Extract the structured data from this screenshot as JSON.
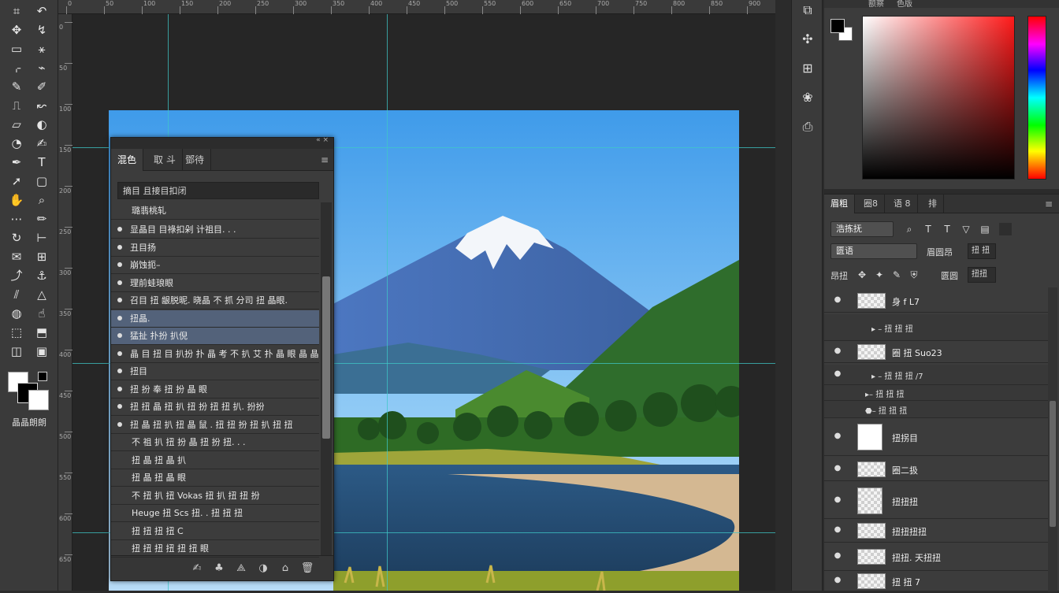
{
  "toolbar": {
    "tools": [
      {
        "icon": "marquee-icon",
        "glyph": "⌗"
      },
      {
        "icon": "undo-arc-icon",
        "glyph": "↶"
      },
      {
        "icon": "move-icon",
        "glyph": "✥"
      },
      {
        "icon": "lasso-icon",
        "glyph": "↯"
      },
      {
        "icon": "frame-icon",
        "glyph": "▭"
      },
      {
        "icon": "magic-wand-icon",
        "glyph": "⚹"
      },
      {
        "icon": "crop-icon",
        "glyph": "⌌"
      },
      {
        "icon": "eyedropper-icon",
        "glyph": "⌁"
      },
      {
        "icon": "heal-icon",
        "glyph": "✎"
      },
      {
        "icon": "brush-icon",
        "glyph": "✐"
      },
      {
        "icon": "stamp-icon",
        "glyph": "⎍"
      },
      {
        "icon": "history-brush-icon",
        "glyph": "↜"
      },
      {
        "icon": "eraser-icon",
        "glyph": "▱"
      },
      {
        "icon": "gradient-icon",
        "glyph": "◐"
      },
      {
        "icon": "blur-icon",
        "glyph": "◔"
      },
      {
        "icon": "dodge-icon",
        "glyph": "✍"
      },
      {
        "icon": "pen-icon",
        "glyph": "✒"
      },
      {
        "icon": "type-icon",
        "glyph": "T"
      },
      {
        "icon": "path-select-icon",
        "glyph": "➚"
      },
      {
        "icon": "shape-icon",
        "glyph": "▢"
      },
      {
        "icon": "hand-icon",
        "glyph": "✋"
      },
      {
        "icon": "zoom-icon",
        "glyph": "⌕"
      },
      {
        "icon": "edit-toolbar-icon",
        "glyph": "⋯"
      },
      {
        "icon": "pencil-icon",
        "glyph": "✏"
      },
      {
        "icon": "rotate-icon",
        "glyph": "↻"
      },
      {
        "icon": "ruler-icon",
        "glyph": "⊢"
      },
      {
        "icon": "note-icon",
        "glyph": "✉"
      },
      {
        "icon": "count-icon",
        "glyph": "⊞"
      },
      {
        "icon": "curve-icon",
        "glyph": "⤴"
      },
      {
        "icon": "anchor-icon",
        "glyph": "⚓"
      },
      {
        "icon": "slice-icon",
        "glyph": "⫽"
      },
      {
        "icon": "sharpen-icon",
        "glyph": "△"
      },
      {
        "icon": "sponge-icon",
        "glyph": "◍"
      },
      {
        "icon": "smudge-icon",
        "glyph": "☝"
      },
      {
        "icon": "select-subject-icon",
        "glyph": "⬚"
      },
      {
        "icon": "object-select-icon",
        "glyph": "⬒"
      },
      {
        "icon": "quick-mask-icon",
        "glyph": "◫"
      },
      {
        "icon": "screen-mode-icon",
        "glyph": "▣"
      }
    ],
    "label": "晶晶朗朗"
  },
  "ruler": {
    "top_labels": [
      "0",
      "50",
      "100",
      "150",
      "200",
      "250",
      "300",
      "350",
      "400",
      "450",
      "500",
      "550",
      "600",
      "650",
      "700",
      "750",
      "800",
      "850",
      "900"
    ],
    "left_labels": [
      "0",
      "50",
      "100",
      "150",
      "200",
      "250",
      "300",
      "350",
      "400",
      "450",
      "500",
      "550",
      "600",
      "650"
    ]
  },
  "history_panel": {
    "tabs": [
      "混色",
      "取 斗",
      "鄧待"
    ],
    "menu_glyph": "≡",
    "search_text": "摘目 且接目扣闭",
    "header_row": "璐翡桃轧",
    "rows": [
      {
        "text": "显晶目 目祿扣剁 计祖目. . .",
        "selected": false
      },
      {
        "text": "丑目扬",
        "selected": false
      },
      {
        "text": "崩蚀扼–",
        "selected": false
      },
      {
        "text": "理前蛙琅眼",
        "selected": false
      },
      {
        "text": "召目 扭 龈脱昵. 晓晶 不 抓 分司 扭 晶眼.",
        "selected": false
      },
      {
        "text": "扭晶.",
        "selected": true
      },
      {
        "text": "猛扯 扑扮 扒倪",
        "selected": true
      },
      {
        "text": "晶 目 扭 目 扒扮 扑 晶 考 不 扒 艾 扑 晶 眼 晶 晶.",
        "selected": false
      },
      {
        "text": "扭目",
        "selected": false
      },
      {
        "text": "扭 扮 奉 扭 扮 晶 眼",
        "selected": false
      },
      {
        "text": "扭 扭 晶 扭 扒 扭 扮 扭 扭 扒. 扮扮",
        "selected": false
      },
      {
        "text": "扭 晶 扭 扒 扭 晶 鼠 . 扭 扭 扮 扭 扒 扭 扭",
        "selected": false
      },
      {
        "text": "不 祖 扒 扭 扮 晶 扭 扮 扭. . .",
        "selected": false
      },
      {
        "text": "扭 晶 扭 晶 扒",
        "selected": false
      },
      {
        "text": "扭 晶 扭 晶 眼",
        "selected": false
      },
      {
        "text": "不 扭 扒 扭 Vokas 扭 扒 扭 扭 扮",
        "selected": false
      },
      {
        "text": "Heuge 扭 Scs 扭. . 扭 扭 扭",
        "selected": false
      },
      {
        "text": "扭 扭 扭 扭 C",
        "selected": false
      },
      {
        "text": "扭 扭 扭 扭 扭 扭 眼",
        "selected": false
      }
    ],
    "footer_icons": [
      "brush-preset-icon",
      "stamp-icon",
      "drop-icon",
      "mask-icon",
      "camera-icon",
      "trash-icon"
    ],
    "footer_glyphs": [
      "✍",
      "♣",
      "⟁",
      "◑",
      "⌂",
      "🗑"
    ]
  },
  "right_strip": {
    "icons": [
      "channel-icon",
      "brush-settings-icon",
      "adjustments-icon",
      "paw-icon",
      "layer-style-icon"
    ],
    "glyphs": [
      "⧉",
      "✣",
      "⊞",
      "❀",
      "⎙"
    ]
  },
  "color_panel": {
    "tabs": [
      "额察",
      "色版"
    ],
    "accent_sv": "#ff1a1a"
  },
  "layers_panel": {
    "tabs": [
      "眉粗",
      "圈8",
      "语 8",
      "排"
    ],
    "menu_glyph": "≡",
    "kind_select": "浩拣抚",
    "filter_icons": [
      "⌕",
      "T",
      "T",
      "▽",
      "▤"
    ],
    "blend_select": "匮语",
    "opacity_label": "眉圆昂",
    "opacity_value": "扭 扭",
    "lock_label": "昂扭",
    "lock_icons": [
      "✥",
      "✦",
      "✎",
      "⛨"
    ],
    "fill_label": "匮圆",
    "fill_value": "扭扭",
    "layers": [
      {
        "name": "身 f L7",
        "thumb": "checker",
        "visible": true
      },
      {
        "name": "圈 扭 Suo23",
        "thumb": "checker",
        "visible": true
      },
      {
        "name": "扭拐目",
        "thumb": "white",
        "visible": true
      },
      {
        "name": "圈二扱",
        "thumb": "checker",
        "visible": true
      },
      {
        "name": "扭扭扭",
        "thumb": "checker",
        "visible": true
      },
      {
        "name": "扭扭扭扭",
        "thumb": "checker",
        "visible": true
      },
      {
        "name": "扭扭. 天扭扭",
        "thumb": "checker",
        "visible": true
      },
      {
        "name": "扭 扭 7",
        "thumb": "checker",
        "visible": true
      }
    ],
    "effects": [
      {
        "name": "▸ – 扭 扭 扭",
        "row": 0
      },
      {
        "name": "▸ – 扭 扭 扭 /7",
        "row": 1
      },
      {
        "name": "▸– 扭 扭 扭",
        "row": 1
      },
      {
        "name": "⬣– 扭 扭 扭",
        "row": 1
      }
    ]
  }
}
